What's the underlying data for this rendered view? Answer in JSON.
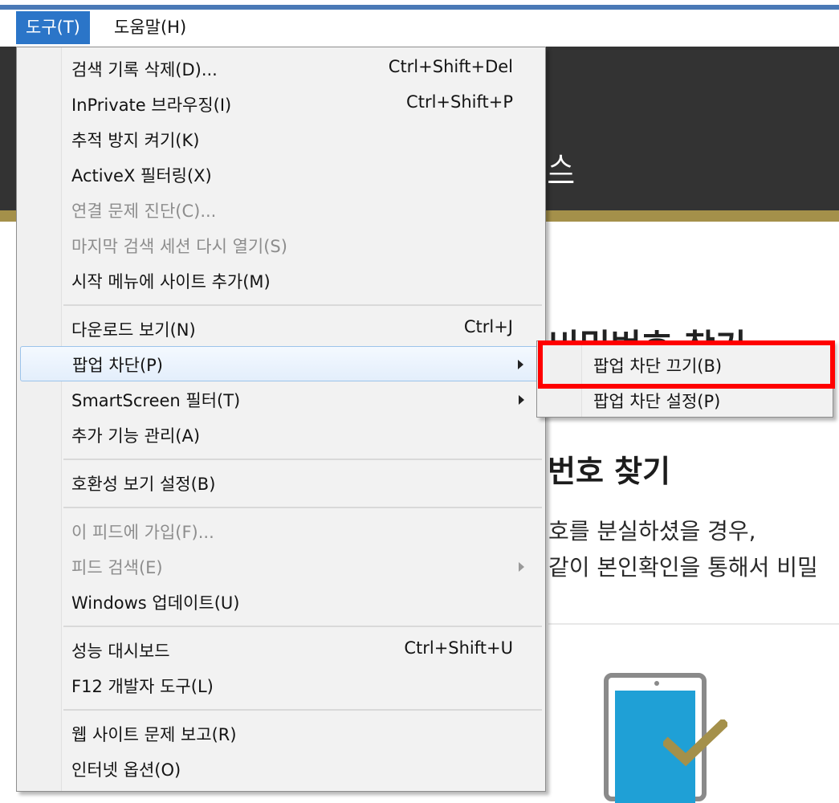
{
  "menubar": {
    "items": [
      {
        "label": "도구(T)",
        "active": true
      },
      {
        "label": "도움말(H)",
        "active": false
      }
    ]
  },
  "background_page": {
    "header_fragment": "스",
    "heading_fragment": "비밀번호 찾기",
    "section_title": "번호 찾기",
    "description_lines": [
      "호를 분실하셨을 경우,",
      "같이 본인확인을 통해서 비밀"
    ],
    "colors": {
      "header": "#333333",
      "gold": "#a4904a",
      "phone_screen": "#1fa0d6"
    }
  },
  "tools_menu": {
    "items": [
      {
        "label": "검색 기록 삭제(D)...",
        "shortcut": "Ctrl+Shift+Del",
        "enabled": true
      },
      {
        "label": "InPrivate 브라우징(I)",
        "shortcut": "Ctrl+Shift+P",
        "enabled": true
      },
      {
        "label": "추적 방지 켜기(K)",
        "shortcut": "",
        "enabled": true
      },
      {
        "label": "ActiveX 필터링(X)",
        "shortcut": "",
        "enabled": true
      },
      {
        "label": "연결 문제 진단(C)...",
        "shortcut": "",
        "enabled": false
      },
      {
        "label": "마지막 검색 세션 다시 열기(S)",
        "shortcut": "",
        "enabled": false
      },
      {
        "label": "시작 메뉴에 사이트 추가(M)",
        "shortcut": "",
        "enabled": true
      },
      {
        "label": "다운로드 보기(N)",
        "shortcut": "Ctrl+J",
        "enabled": true
      },
      {
        "label": "팝업 차단(P)",
        "shortcut": "",
        "enabled": true,
        "submenu": true,
        "hovered": true
      },
      {
        "label": "SmartScreen 필터(T)",
        "shortcut": "",
        "enabled": true,
        "submenu": true
      },
      {
        "label": "추가 기능 관리(A)",
        "shortcut": "",
        "enabled": true
      },
      {
        "label": "호환성 보기 설정(B)",
        "shortcut": "",
        "enabled": true
      },
      {
        "label": "이 피드에 가입(F)...",
        "shortcut": "",
        "enabled": false
      },
      {
        "label": "피드 검색(E)",
        "shortcut": "",
        "enabled": false,
        "submenu": true
      },
      {
        "label": "Windows 업데이트(U)",
        "shortcut": "",
        "enabled": true
      },
      {
        "label": "성능 대시보드",
        "shortcut": "Ctrl+Shift+U",
        "enabled": true
      },
      {
        "label": "F12 개발자 도구(L)",
        "shortcut": "",
        "enabled": true
      },
      {
        "label": "웹 사이트 문제 보고(R)",
        "shortcut": "",
        "enabled": true
      },
      {
        "label": "인터넷 옵션(O)",
        "shortcut": "",
        "enabled": true
      }
    ]
  },
  "popup_submenu": {
    "items": [
      {
        "label": "팝업 차단 끄기(B)",
        "highlighted": true
      },
      {
        "label": "팝업 차단 설정(P)",
        "highlighted": false
      }
    ],
    "highlight_color": "#ff0000"
  },
  "colors": {
    "menubar_active": "#2b75c8",
    "menu_background": "#f2f2f2",
    "disabled_text": "#8d8d8d",
    "hover_border": "#9cc3ea"
  }
}
